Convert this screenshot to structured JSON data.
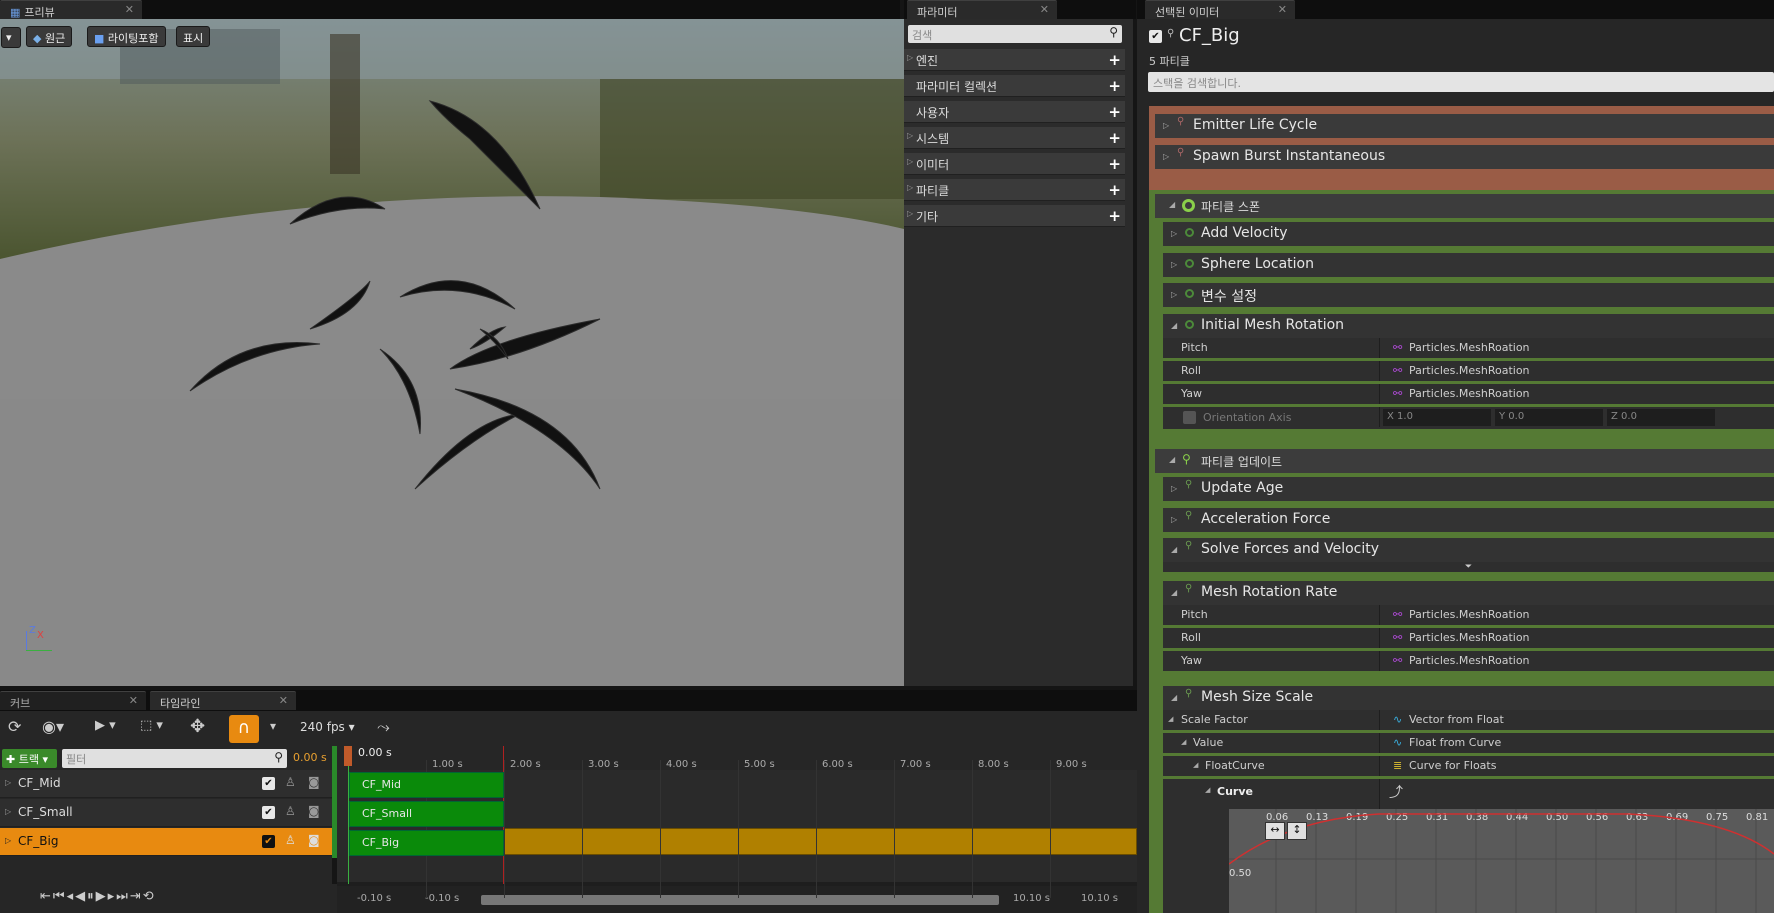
{
  "tabs": {
    "preview": "프리뷰",
    "params": "파라미터",
    "selected": "선택된 이미터",
    "curve": "커브",
    "timeline": "타임라인"
  },
  "viewport": {
    "perspective_btn": "원근",
    "lighting_btn": "라이팅포함",
    "show_btn": "표시",
    "axis_z": "Z",
    "axis_x": "X"
  },
  "params": {
    "search_placeholder": "검색",
    "sections": [
      "엔진",
      "파라미터 컬렉션",
      "사용자",
      "시스템",
      "이미터",
      "파티클",
      "기타"
    ]
  },
  "emitter": {
    "name": "CF_Big",
    "particles": "5 파티클",
    "search_placeholder": "스택을 검색합니다.",
    "modules": {
      "life": "Emitter Life Cycle",
      "burst": "Spawn Burst Instantaneous",
      "spawn_header": "파티클 스폰",
      "velocity": "Add Velocity",
      "sphere": "Sphere Location",
      "var": "변수 설정",
      "init_rot": "Initial Mesh Rotation",
      "update_header": "파티클 업데이트",
      "update_age": "Update Age",
      "accel": "Acceleration Force",
      "solve": "Solve Forces and Velocity",
      "rot_rate": "Mesh Rotation Rate",
      "size_scale": "Mesh Size Scale"
    },
    "init_rot_rows": [
      {
        "label": "Pitch",
        "value": "Particles.MeshRoation"
      },
      {
        "label": "Roll",
        "value": "Particles.MeshRoation"
      },
      {
        "label": "Yaw",
        "value": "Particles.MeshRoation"
      }
    ],
    "orientation": {
      "label": "Orientation Axis",
      "x": "X 1.0",
      "y": "Y 0.0",
      "z": "Z 0.0"
    },
    "rot_rate_rows": [
      {
        "label": "Pitch",
        "value": "Particles.MeshRoation"
      },
      {
        "label": "Roll",
        "value": "Particles.MeshRoation"
      },
      {
        "label": "Yaw",
        "value": "Particles.MeshRoation"
      }
    ],
    "scale_rows": [
      {
        "label": "Scale Factor",
        "value": "Vector from Float"
      },
      {
        "label": "Value",
        "value": "Float from Curve"
      },
      {
        "label": "FloatCurve",
        "value": "Curve for Floats"
      },
      {
        "label": "Curve",
        "value": ""
      }
    ],
    "curve_ticks": [
      "0.06",
      "0.13",
      "0.19",
      "0.25",
      "0.31",
      "0.38",
      "0.44",
      "0.50",
      "0.56",
      "0.63",
      "0.69",
      "0.75",
      "0.81"
    ],
    "curve_ylabel": "0.50"
  },
  "timeline": {
    "fps": "240 fps",
    "track_btn": "트랙",
    "filter_placeholder": "필터",
    "current_time": "0.00 s",
    "playhead": "0.00 s",
    "ticks": [
      "1.00 s",
      "2.00 s",
      "3.00 s",
      "4.00 s",
      "5.00 s",
      "6.00 s",
      "7.00 s",
      "8.00 s",
      "9.00 s"
    ],
    "tracks": [
      "CF_Mid",
      "CF_Small",
      "CF_Big"
    ],
    "range_start_a": "-0.10 s",
    "range_start_b": "-0.10 s",
    "range_end_a": "10.10 s",
    "range_end_b": "10.10 s"
  }
}
